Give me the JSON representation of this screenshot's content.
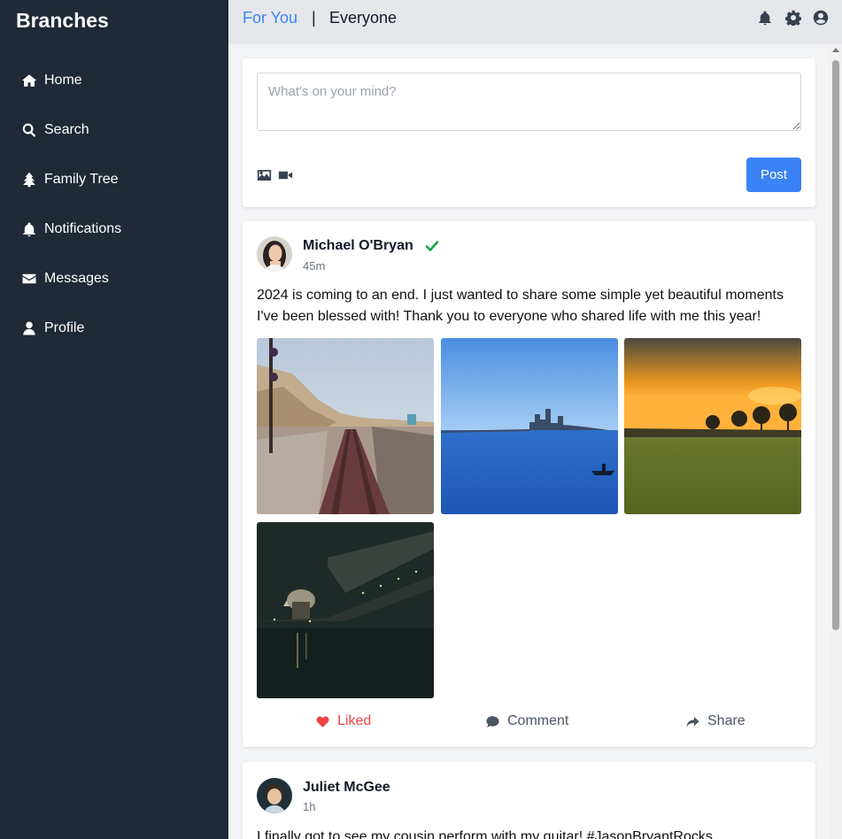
{
  "app": {
    "brand": "Branches"
  },
  "sidebar": {
    "items": [
      {
        "label": "Home",
        "icon": "home-icon"
      },
      {
        "label": "Search",
        "icon": "search-icon"
      },
      {
        "label": "Family Tree",
        "icon": "tree-icon"
      },
      {
        "label": "Notifications",
        "icon": "bell-icon"
      },
      {
        "label": "Messages",
        "icon": "envelope-icon"
      },
      {
        "label": "Profile",
        "icon": "user-icon"
      }
    ]
  },
  "topbar": {
    "tabs": [
      {
        "label": "For You",
        "active": true
      },
      {
        "label": "|"
      },
      {
        "label": "Everyone",
        "active": false
      }
    ],
    "icons": [
      "bell-icon",
      "gear-icon",
      "account-icon"
    ]
  },
  "composer": {
    "placeholder": "What's on your mind?",
    "post_label": "Post",
    "icons": [
      "image-icon",
      "video-icon"
    ]
  },
  "posts": [
    {
      "author": "Michael O'Bryan",
      "time": "45m",
      "verified": true,
      "text": "2024 is coming to an end. I just wanted to share some simple yet beautiful moments I've been blessed with! Thank you to everyone who shared life with me this year!",
      "actions": {
        "like": "Liked",
        "comment": "Comment",
        "share": "Share"
      }
    },
    {
      "author": "Juliet McGee",
      "time": "1h",
      "text": "I finally got to see my cousin perform with my guitar! #JasonBryantRocks"
    }
  ],
  "colors": {
    "accent": "#3b82f6",
    "sidebar": "#1f2937",
    "liked": "#ef4444",
    "verified": "#16a34a"
  }
}
